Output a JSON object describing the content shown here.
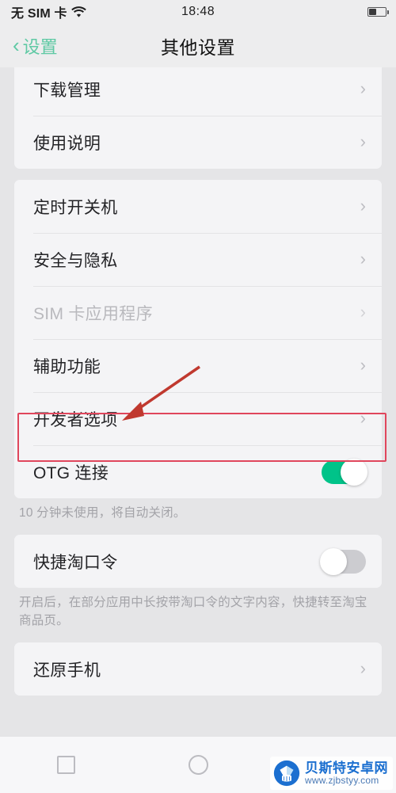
{
  "status_bar": {
    "carrier": "无 SIM 卡",
    "wifi_icon": "wifi-icon",
    "time": "18:48",
    "battery_icon": "battery-icon",
    "battery_level_percent": 45
  },
  "nav_bar": {
    "back_icon": "chevron-left-icon",
    "back_label": "设置",
    "title": "其他设置"
  },
  "groups": [
    {
      "id": "group-downloads",
      "rows": [
        {
          "label": "下载管理",
          "type": "link",
          "disabled": false
        },
        {
          "label": "使用说明",
          "type": "link",
          "disabled": false
        }
      ]
    },
    {
      "id": "group-system",
      "rows": [
        {
          "label": "定时开关机",
          "type": "link",
          "disabled": false
        },
        {
          "label": "安全与隐私",
          "type": "link",
          "disabled": false
        },
        {
          "label": "SIM 卡应用程序",
          "type": "link",
          "disabled": true
        },
        {
          "label": "辅助功能",
          "type": "link",
          "disabled": false
        },
        {
          "label": "开发者选项",
          "type": "link",
          "disabled": false,
          "highlighted": true
        },
        {
          "label": "OTG 连接",
          "type": "toggle",
          "toggle_state": "on"
        }
      ],
      "footnote": "10 分钟未使用，将自动关闭。"
    },
    {
      "id": "group-taobao",
      "rows": [
        {
          "label": "快捷淘口令",
          "type": "toggle",
          "toggle_state": "off"
        }
      ],
      "footnote": "开启后，在部分应用中长按带淘口令的文字内容，快捷转至淘宝商品页。"
    },
    {
      "id": "group-reset",
      "rows": [
        {
          "label": "还原手机",
          "type": "link",
          "disabled": false
        }
      ]
    }
  ],
  "annotation": {
    "highlight_target": "开发者选项",
    "box_color": "#e0465c",
    "arrow_color": "#c0392f"
  },
  "bottom_nav": {
    "keys": [
      {
        "icon": "square-recents-icon"
      },
      {
        "icon": "circle-home-icon"
      },
      {
        "icon": "triangle-back-icon"
      }
    ]
  },
  "watermark": {
    "logo_icon": "gem-logo-icon",
    "title": "贝斯特安卓网",
    "url": "www.zjbstyy.com"
  },
  "colors": {
    "accent_green": "#5fc9a4",
    "toggle_on": "#00c389",
    "toggle_off": "#ccccd0",
    "page_bg": "#e5e5e7",
    "card_bg": "#f4f4f6"
  }
}
